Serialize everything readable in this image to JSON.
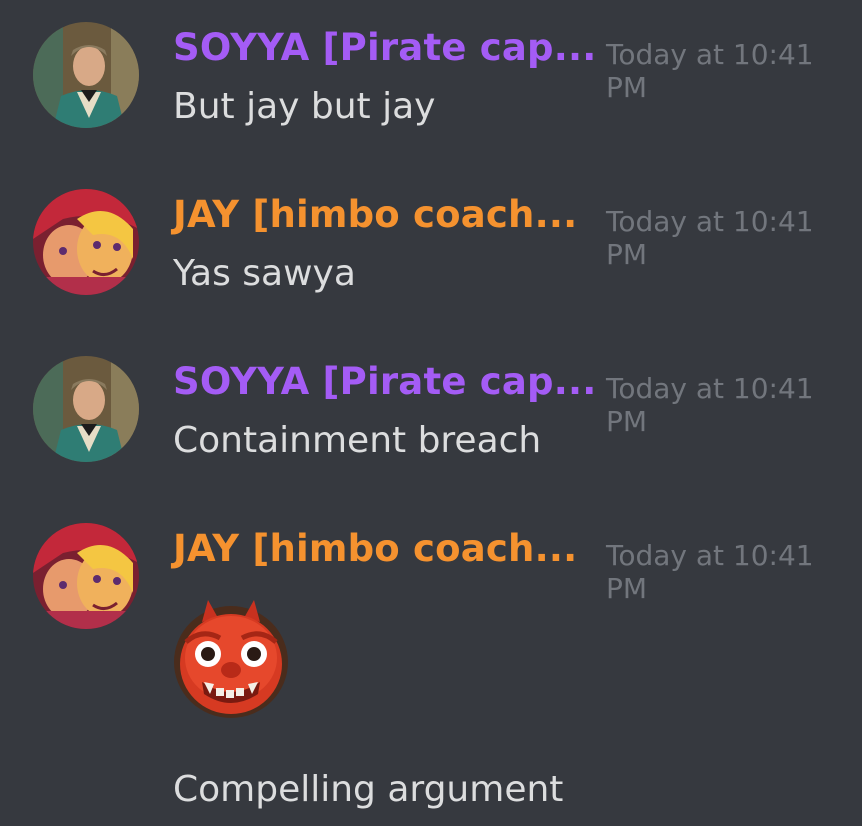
{
  "messages": [
    {
      "username": "SOYYA [Pirate cap...",
      "username_color": "#a45cf5",
      "timestamp": "Today at 10:41 PM",
      "text": "But jay but jay",
      "avatar": "soyya-avatar"
    },
    {
      "username": "JAY [himbo coach...",
      "username_color": "#f5922f",
      "timestamp": "Today at 10:41 PM",
      "text": "Yas sawya",
      "avatar": "jay-avatar"
    },
    {
      "username": "SOYYA [Pirate cap...",
      "username_color": "#a45cf5",
      "timestamp": "Today at 10:41 PM",
      "text": "Containment breach",
      "avatar": "soyya-avatar"
    },
    {
      "username": "JAY [himbo coach...",
      "username_color": "#f5922f",
      "timestamp": "Today at 10:41 PM",
      "emoji": "oni-emoji",
      "text": "Compelling argument",
      "avatar": "jay-avatar"
    }
  ],
  "colors": {
    "background": "#36393f",
    "message_text": "#dcddde",
    "timestamp": "#72767d"
  }
}
